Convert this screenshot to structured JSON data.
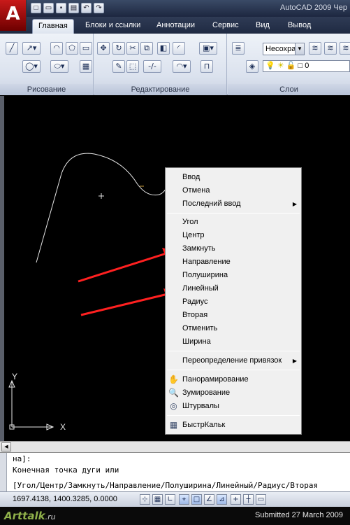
{
  "titlebar": {
    "app_letter": "A",
    "title": "AutoCAD 2009 Чер",
    "qat": [
      "new-icon",
      "open-icon",
      "save-icon",
      "plot-icon",
      "undo-icon",
      "redo-icon"
    ]
  },
  "tabs": [
    {
      "label": "Главная",
      "active": true
    },
    {
      "label": "Блоки и ссылки"
    },
    {
      "label": "Аннотации"
    },
    {
      "label": "Сервис"
    },
    {
      "label": "Вид"
    },
    {
      "label": "Вывод"
    }
  ],
  "panels": {
    "draw": "Рисование",
    "modify": "Редактирование",
    "layers": "Слои"
  },
  "layers": {
    "combo_value": "Несохра",
    "current_layer": "0"
  },
  "context_menu": {
    "items": [
      {
        "label": "Ввод"
      },
      {
        "label": "Отмена"
      },
      {
        "label": "Последний ввод",
        "submenu": "▶"
      },
      {
        "label": "Угол"
      },
      {
        "label": "Центр"
      },
      {
        "label": "Замкнуть"
      },
      {
        "label": "Направление"
      },
      {
        "label": "Полуширина"
      },
      {
        "label": "Линейный"
      },
      {
        "label": "Радиус"
      },
      {
        "label": "Вторая"
      },
      {
        "label": "Отменить"
      },
      {
        "label": "Ширина"
      },
      {
        "label": "Переопределение привязок",
        "submenu": "▶"
      },
      {
        "label": "Панорамирование",
        "icon": "pan-icon"
      },
      {
        "label": "Зумирование",
        "icon": "zoom-icon"
      },
      {
        "label": "Штурвалы",
        "icon": "steeringwheel-icon"
      },
      {
        "label": "БыстрКальк",
        "icon": "calculator-icon"
      }
    ]
  },
  "ucs": {
    "y_label": "Y",
    "x_label": "X"
  },
  "command_line": {
    "line1": "на]:",
    "line2": "Конечная точка дуги или",
    "line3": "[Угол/Центр/Замкнуть/Направление/Полуширина/Линейный/Радиус/Вторая"
  },
  "status": {
    "coords": "1697.4138, 1400.3285, 0.0000"
  },
  "footer": {
    "logo": "Arttalk",
    "logo_domain": ".ru",
    "submitted": "Submitted 27 March 2009"
  },
  "colors": {
    "annotation_arrow": "#ff2020",
    "canvas_bg": "#000000",
    "polyline": "#e6e6e6"
  }
}
